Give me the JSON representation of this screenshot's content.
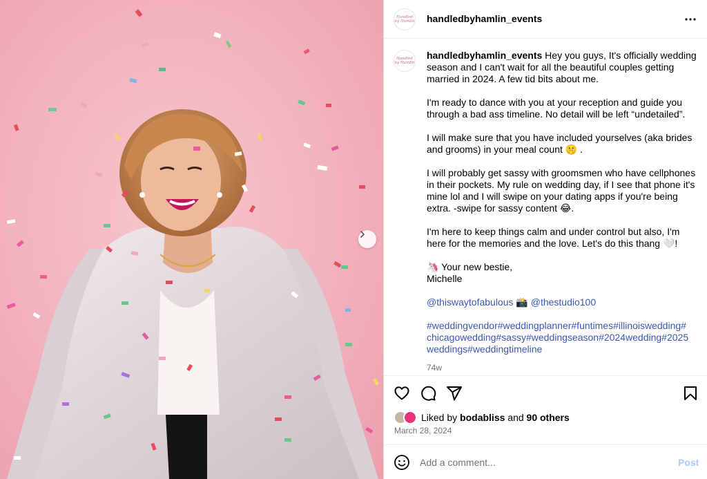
{
  "post": {
    "username": "handledbyhamlin_events",
    "avatar_text": "Handled by Hamlin",
    "more_icon": "more-horizontal-icon",
    "next_icon": "chevron-right-icon"
  },
  "caption": {
    "username": "handledbyhamlin_events",
    "intro": "Hey you guys, It's officially wedding season and I can't wait for all the beautiful couples getting married in 2024. A few tid bits about me.",
    "p2": "I'm ready to dance with you at your reception and guide you through a bad ass timeline. No detail will be left “undetailed”.",
    "p3": "I will make sure that you have included yourselves (aka brides and grooms) in your meal count 🤫 .",
    "p4": "I will probably get sassy with groomsmen who have cellphones in their pockets. My rule on wedding day, if I see that phone it's mine lol and I will swipe on your dating apps if you're being extra. -swipe for sassy content 😂.",
    "p5": "I'm here to keep things calm and under control but also, I'm here for the memories and the love. Let's do this thang 🤍!",
    "signoff_line1": "🦄 Your new bestie,",
    "signoff_line2": "Michelle",
    "mention1": "@thiswaytofabulous",
    "mention_sep": " 📸 ",
    "mention2": "@thestudio100",
    "hashtags": [
      "#weddingvendor",
      "#weddingplanner",
      "#funtimes",
      "#illinoiswedding",
      "#",
      "chicagowedding",
      "#sassy",
      "#weddingseason",
      "#2024wedding",
      "#2025",
      "weddings",
      "#weddingtimeline"
    ],
    "age": "74w"
  },
  "actions": {
    "like_icon": "heart-icon",
    "comment_icon": "comment-icon",
    "share_icon": "share-icon",
    "save_icon": "bookmark-icon"
  },
  "likes": {
    "prefix": "Liked by ",
    "user": "bodabliss",
    "middle": " and ",
    "others": "90 others"
  },
  "date": "March 28, 2024",
  "comment": {
    "emoji_icon": "emoji-icon",
    "placeholder": "Add a comment...",
    "post_label": "Post"
  },
  "colors": {
    "link": "#3d56b2",
    "post_disabled": "#b2c8f5",
    "photo_bg": "#f2b2bd"
  }
}
